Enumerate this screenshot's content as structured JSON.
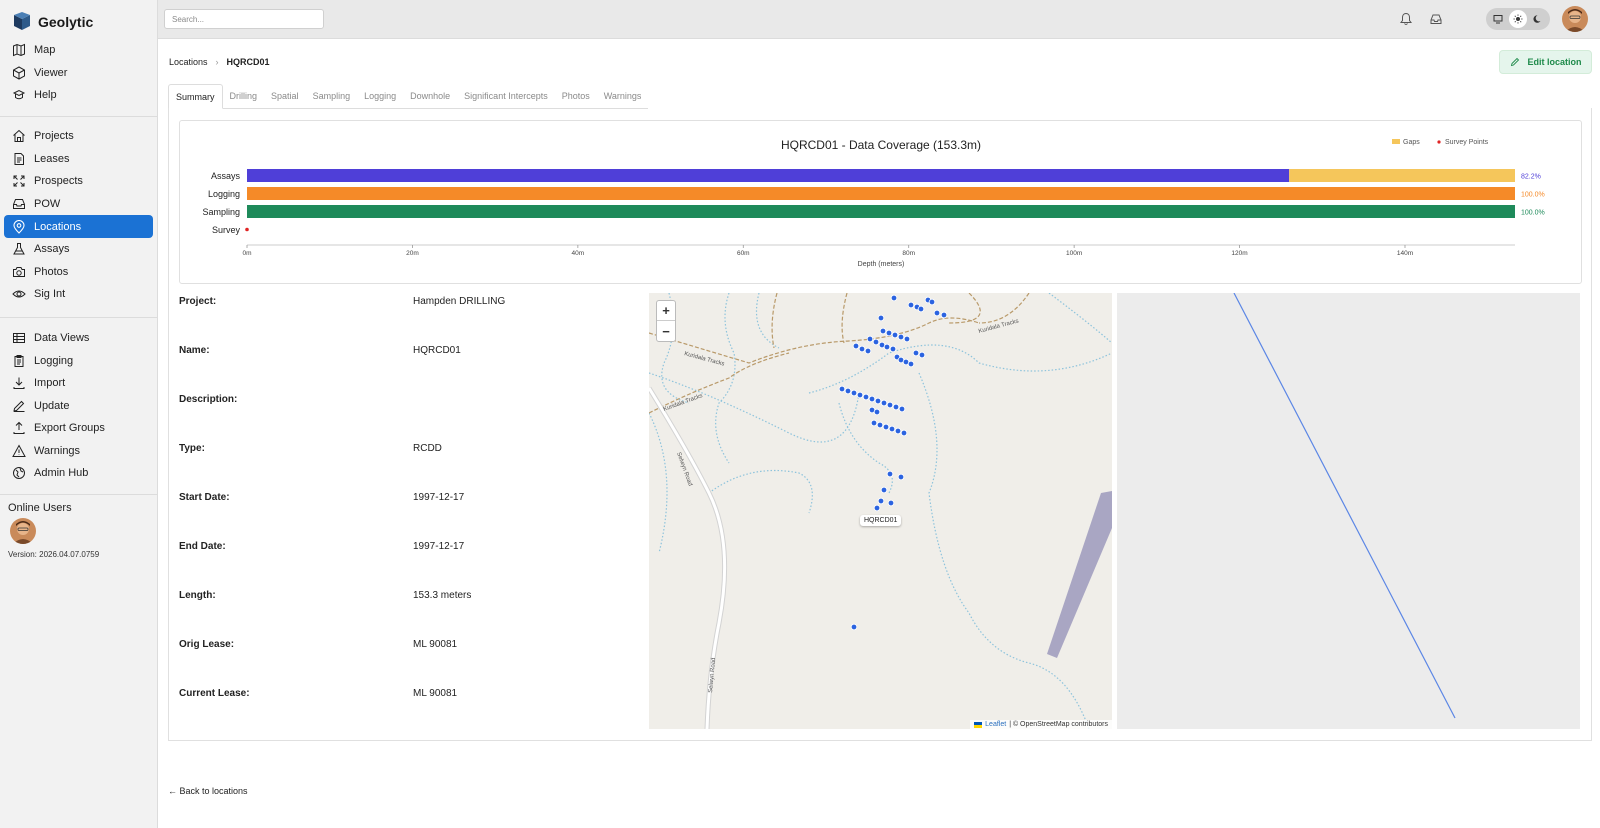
{
  "app": {
    "name": "Geolytic"
  },
  "sidebar": {
    "group1": [
      {
        "label": "Map",
        "icon": "map-icon"
      },
      {
        "label": "Viewer",
        "icon": "cube-icon"
      },
      {
        "label": "Help",
        "icon": "help-icon"
      }
    ],
    "group2": [
      {
        "label": "Projects",
        "icon": "home-icon"
      },
      {
        "label": "Leases",
        "icon": "document-icon"
      },
      {
        "label": "Prospects",
        "icon": "scatter-icon"
      },
      {
        "label": "POW",
        "icon": "inbox-icon"
      },
      {
        "label": "Locations",
        "icon": "location-pin-icon",
        "active": true
      },
      {
        "label": "Assays",
        "icon": "flask-icon"
      },
      {
        "label": "Photos",
        "icon": "camera-icon"
      },
      {
        "label": "Sig Int",
        "icon": "eye-icon"
      }
    ],
    "group3": [
      {
        "label": "Data Views",
        "icon": "table-icon"
      },
      {
        "label": "Logging",
        "icon": "clipboard-icon"
      },
      {
        "label": "Import",
        "icon": "download-icon"
      },
      {
        "label": "Update",
        "icon": "edit-icon"
      },
      {
        "label": "Export Groups",
        "icon": "upload-icon"
      },
      {
        "label": "Warnings",
        "icon": "warning-icon"
      },
      {
        "label": "Admin Hub",
        "icon": "globe-icon"
      }
    ],
    "online_users_title": "Online Users",
    "version": "Version: 2026.04.07.0759"
  },
  "topbar": {
    "search_placeholder": "Search..."
  },
  "breadcrumb": {
    "parent": "Locations",
    "current": "HQRCD01"
  },
  "edit_button": {
    "label": "Edit location"
  },
  "tabs": [
    {
      "label": "Summary",
      "active": true
    },
    {
      "label": "Drilling"
    },
    {
      "label": "Spatial"
    },
    {
      "label": "Sampling"
    },
    {
      "label": "Logging"
    },
    {
      "label": "Downhole"
    },
    {
      "label": "Significant Intercepts"
    },
    {
      "label": "Photos"
    },
    {
      "label": "Warnings"
    }
  ],
  "chart_data": {
    "type": "bar",
    "orientation": "horizontal",
    "title": "HQRCD01 - Data Coverage (153.3m)",
    "xlabel": "Depth (meters)",
    "xlim": [
      0,
      153.3
    ],
    "xticks": [
      "0m",
      "20m",
      "40m",
      "60m",
      "80m",
      "100m",
      "120m",
      "140m"
    ],
    "xtick_values": [
      0,
      20,
      40,
      60,
      80,
      100,
      120,
      140
    ],
    "legend": [
      {
        "name": "Gaps",
        "color": "#f5c65b",
        "marker": "square"
      },
      {
        "name": "Survey Points",
        "color": "#e02424",
        "marker": "dot"
      }
    ],
    "legend_position": "top-right",
    "categories": [
      "Assays",
      "Logging",
      "Sampling",
      "Survey"
    ],
    "rows": [
      {
        "name": "Assays",
        "covered": [
          [
            0,
            126.0
          ]
        ],
        "gaps": [
          [
            126.0,
            153.3
          ]
        ],
        "color": "#4f3fd8",
        "percent": "82.2%"
      },
      {
        "name": "Logging",
        "covered": [
          [
            0,
            153.3
          ]
        ],
        "gaps": [],
        "color": "#f58a28",
        "percent": "100.0%"
      },
      {
        "name": "Sampling",
        "covered": [
          [
            0,
            153.3
          ]
        ],
        "gaps": [],
        "color": "#1e8a5a",
        "percent": "100.0%"
      },
      {
        "name": "Survey",
        "points": [
          0
        ],
        "color": "#e02424",
        "percent": ""
      }
    ]
  },
  "details": [
    {
      "label": "Project:",
      "value": "Hampden DRILLING"
    },
    {
      "label": "Name:",
      "value": "HQRCD01"
    },
    {
      "label": "Description:",
      "value": ""
    },
    {
      "label": "Type:",
      "value": "RCDD"
    },
    {
      "label": "Start Date:",
      "value": "1997-12-17"
    },
    {
      "label": "End Date:",
      "value": "1997-12-17"
    },
    {
      "label": "Length:",
      "value": "153.3 meters"
    },
    {
      "label": "Orig Lease:",
      "value": "ML 90081"
    },
    {
      "label": "Current Lease:",
      "value": "ML 90081"
    }
  ],
  "map": {
    "zoom_in": "+",
    "zoom_out": "−",
    "popup_label": "HQRCD01",
    "attribution_leaflet": "Leaflet",
    "attribution_rest": "| © OpenStreetMap contributors",
    "track_labels": [
      "Kuridala Tracks",
      "Kuridala Tracks",
      "Kuridala Tracks"
    ],
    "road_labels": [
      "Selwyn Road",
      "Selwyn Road"
    ]
  },
  "back_link": "← Back to locations"
}
